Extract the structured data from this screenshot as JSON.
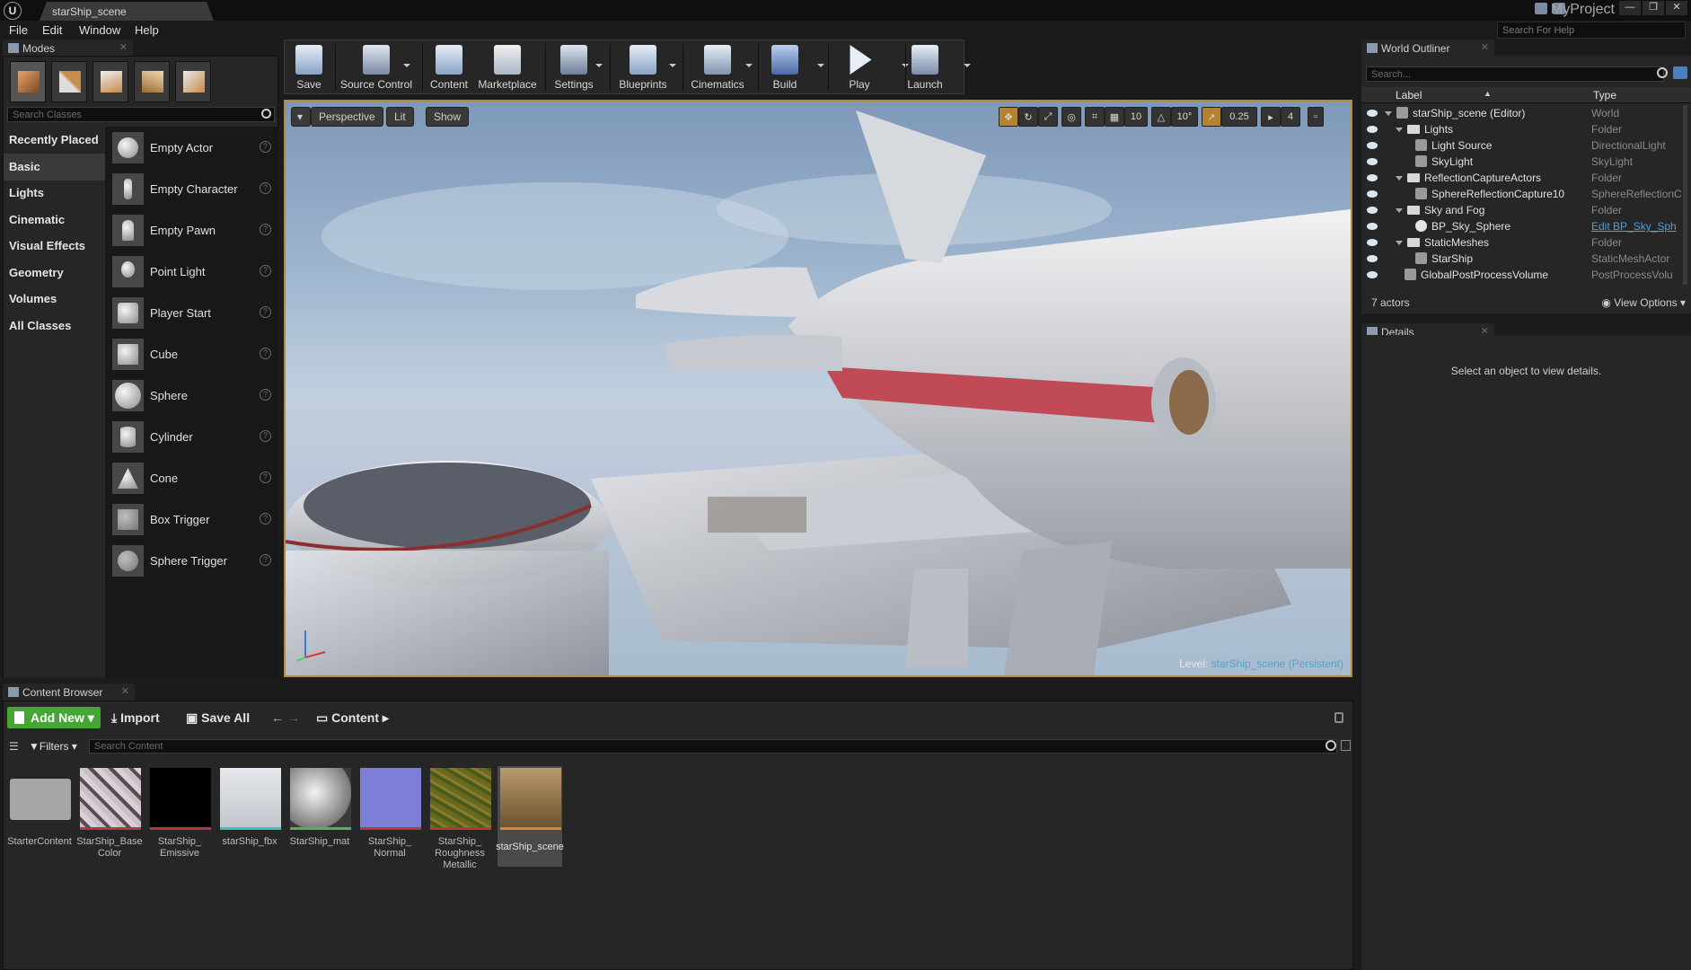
{
  "window": {
    "doc_tab": "starShip_scene",
    "project": "MyProject",
    "help_search_placeholder": "Search For Help"
  },
  "menu": [
    "File",
    "Edit",
    "Window",
    "Help"
  ],
  "modes": {
    "tab": "Modes",
    "search_placeholder": "Search Classes",
    "categories": [
      "Recently Placed",
      "Basic",
      "Lights",
      "Cinematic",
      "Visual Effects",
      "Geometry",
      "Volumes",
      "All Classes"
    ],
    "active_category": "Basic",
    "items": [
      "Empty Actor",
      "Empty Character",
      "Empty Pawn",
      "Point Light",
      "Player Start",
      "Cube",
      "Sphere",
      "Cylinder",
      "Cone",
      "Box Trigger",
      "Sphere Trigger"
    ]
  },
  "toolbar": {
    "buttons": [
      "Save",
      "Source Control",
      "Content",
      "Marketplace",
      "Settings",
      "Blueprints",
      "Cinematics",
      "Build",
      "Play",
      "Launch"
    ]
  },
  "viewport": {
    "perspective": "Perspective",
    "lit": "Lit",
    "show": "Show",
    "grid_snap": "10",
    "rot_snap": "10°",
    "scale_snap": "0.25",
    "camera_speed": "4",
    "level_label": "Level:",
    "level_value": "starShip_scene (Persistent)"
  },
  "outliner": {
    "tab": "World Outliner",
    "search_placeholder": "Search...",
    "col_label": "Label",
    "col_type": "Type",
    "rows": [
      {
        "label": "starShip_scene (Editor)",
        "type": "World"
      },
      {
        "label": "Lights",
        "type": "Folder"
      },
      {
        "label": "Light Source",
        "type": "DirectionalLight"
      },
      {
        "label": "SkyLight",
        "type": "SkyLight"
      },
      {
        "label": "ReflectionCaptureActors",
        "type": "Folder"
      },
      {
        "label": "SphereReflectionCapture10",
        "type": "SphereReflectionC"
      },
      {
        "label": "Sky and Fog",
        "type": "Folder"
      },
      {
        "label": "BP_Sky_Sphere",
        "type": "Edit BP_Sky_Sph"
      },
      {
        "label": "StaticMeshes",
        "type": "Folder"
      },
      {
        "label": "StarShip",
        "type": "StaticMeshActor"
      },
      {
        "label": "GlobalPostProcessVolume",
        "type": "PostProcessVolu"
      }
    ],
    "actor_count": "7 actors",
    "view_options": "View Options"
  },
  "details": {
    "tab": "Details",
    "empty_msg": "Select an object to view details."
  },
  "content_browser": {
    "tab": "Content Browser",
    "add_new": "Add New",
    "import": "Import",
    "save_all": "Save All",
    "path": "Content",
    "filters": "Filters",
    "search_placeholder": "Search Content",
    "assets": [
      {
        "name": "StarterContent",
        "bar": ""
      },
      {
        "name": "StarShip_Base Color",
        "bar": "#b03a3a"
      },
      {
        "name": "StarShip_ Emissive",
        "bar": "#b03a3a"
      },
      {
        "name": "starShip_fbx",
        "bar": "#39c1c8"
      },
      {
        "name": "StarShip_mat",
        "bar": "#52b152"
      },
      {
        "name": "StarShip_ Normal",
        "bar": "#b03a3a"
      },
      {
        "name": "StarShip_ Roughness Metallic",
        "bar": "#b03a3a"
      },
      {
        "name": "starShip_scene",
        "bar": "#d8872a"
      }
    ]
  },
  "colors": {
    "accent_add": "#45a535",
    "viewport_border": "#b28a3a",
    "level_value": "#4fa6c6"
  }
}
